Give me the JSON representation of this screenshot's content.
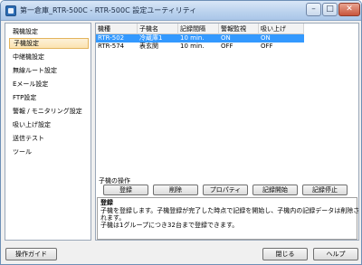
{
  "window": {
    "title": "第一倉庫_RTR-500C - RTR-500C 設定ユーティリティ",
    "minimize_label": "–",
    "maximize_label": "□",
    "close_label": "✕"
  },
  "sidebar": {
    "items": [
      {
        "label": "親機設定",
        "active": false
      },
      {
        "label": "子機設定",
        "active": true
      },
      {
        "label": "中継機設定",
        "active": false
      },
      {
        "label": "無線ルート設定",
        "active": false
      },
      {
        "label": "Eメール設定",
        "active": false
      },
      {
        "label": "FTP設定",
        "active": false
      },
      {
        "label": "警報 / モニタリング設定",
        "active": false
      },
      {
        "label": "吸い上げ設定",
        "active": false
      },
      {
        "label": "送信テスト",
        "active": false
      },
      {
        "label": "ツール",
        "active": false
      }
    ]
  },
  "table": {
    "headers": [
      "機種",
      "子機名",
      "記録間隔",
      "警報監視",
      "吸い上げ"
    ],
    "rows": [
      [
        "RTR-502",
        "冷蔵庫1",
        "10 min.",
        "ON",
        "ON"
      ],
      [
        "RTR-574",
        "表玄関",
        "10 min.",
        "OFF",
        "OFF"
      ]
    ]
  },
  "operations": {
    "title": "子機の操作",
    "buttons": [
      "登録",
      "削除",
      "プロパティ",
      "記録開始",
      "記録停止"
    ]
  },
  "description": {
    "title": "登録",
    "lines": [
      "子機を登録します。子機登録が完了した時点で記録を開始し、子機内の記録データは削除さ",
      "れます。",
      "子機は1グループにつき32台まで登録できます。"
    ]
  },
  "footer": {
    "guide_label": "操作ガイド",
    "close_label": "閉じる",
    "help_label": "ヘルプ"
  },
  "colors": {
    "selection": "#3399ff",
    "active_nav": "#fbe3b0"
  }
}
